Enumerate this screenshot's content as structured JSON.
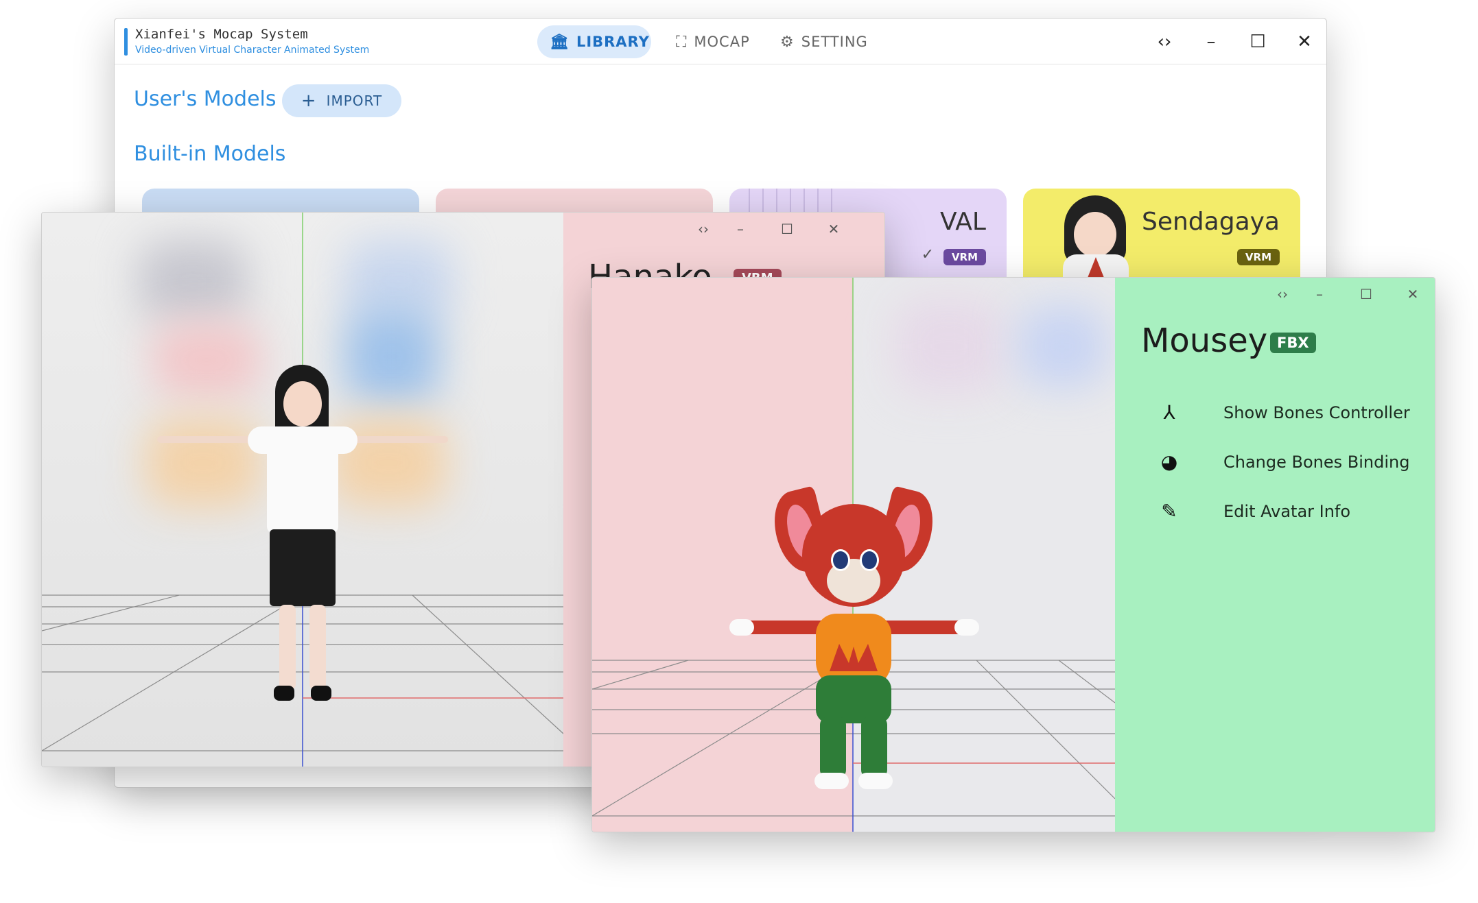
{
  "app": {
    "title": "Xianfei's Mocap System",
    "subtitle": "Video-driven Virtual Character Animated System"
  },
  "nav": {
    "library": "LIBRARY",
    "mocap": "MOCAP",
    "setting": "SETTING"
  },
  "window_controls": {
    "code": "‹›",
    "minimize": "–",
    "maximize": "☐",
    "close": "✕"
  },
  "sections": {
    "user_models": "User's Models",
    "import_label": "IMPORT",
    "builtin_models": "Built-in Models"
  },
  "cards": [
    {
      "name": "",
      "badge": ""
    },
    {
      "name": "",
      "badge": ""
    },
    {
      "name": "VAL",
      "badge": "VRM",
      "selected": true
    },
    {
      "name": "Sendagaya",
      "badge": "VRM"
    }
  ],
  "viewer_hanako": {
    "name": "Hanako",
    "badge": "VRM"
  },
  "viewer_mousey": {
    "name": "Mousey",
    "badge": "FBX",
    "menu": [
      {
        "icon": "bones-icon",
        "label": "Show Bones Controller"
      },
      {
        "icon": "palette-icon",
        "label": "Change Bones Binding"
      },
      {
        "icon": "pencil-icon",
        "label": "Edit Avatar Info"
      }
    ]
  },
  "colors": {
    "accent": "#2f8fe0",
    "vrm_badge": "#6b4aa0",
    "fbx_badge": "#2e7d4a",
    "mousey_panel": "#a8f0c0",
    "hanako_panel": "#f4d3d6",
    "val_card": "#e4d6f7",
    "sendagaya_card": "#f3ec6a"
  }
}
